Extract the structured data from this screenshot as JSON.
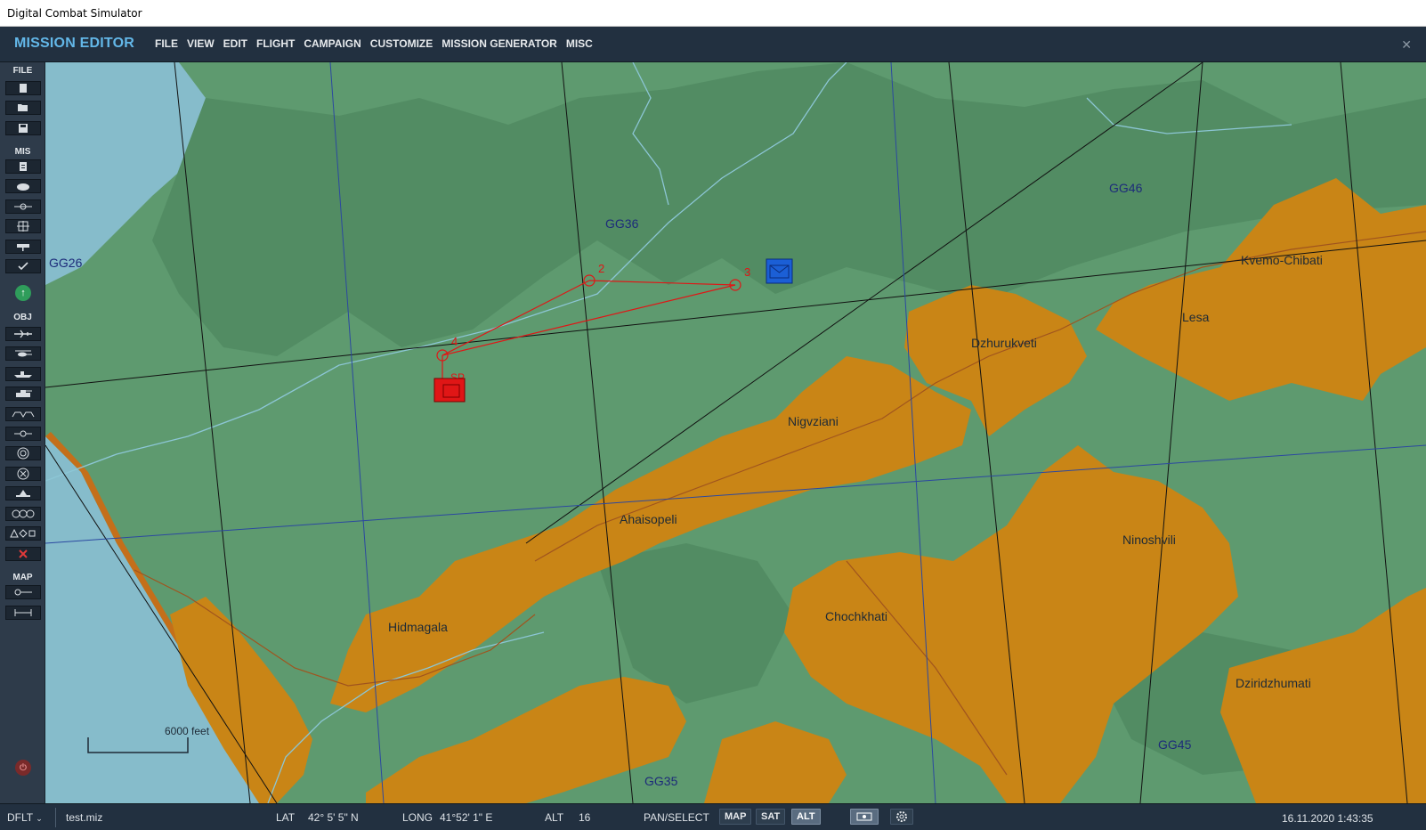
{
  "window": {
    "title": "Digital Combat Simulator"
  },
  "app": {
    "name": "MISSION EDITOR"
  },
  "menu": [
    "FILE",
    "VIEW",
    "EDIT",
    "FLIGHT",
    "CAMPAIGN",
    "CUSTOMIZE",
    "MISSION GENERATOR",
    "MISC"
  ],
  "sidebar": {
    "file_label": "FILE",
    "mis_label": "MIS",
    "obj_label": "OBJ",
    "map_label": "MAP"
  },
  "map": {
    "grid_labels": [
      "GG26",
      "GG36",
      "GG46",
      "GG35",
      "GG45"
    ],
    "towns": [
      "Kvemo-Chibati",
      "Lesa",
      "Dzhurukveti",
      "Nigvziani",
      "Ahaisopeli",
      "Ninoshvili",
      "Chochkhati",
      "Hidmagala",
      "Dziridzhumati"
    ],
    "waypoints": [
      "2",
      "3",
      "4",
      "SP"
    ],
    "scale_label": "6000 feet",
    "colors": {
      "sea": "#86bccb",
      "land": "#5e9a6f",
      "forest": "#518a61",
      "urban": "#c98516",
      "route": "#e01616",
      "blue_unit": "#1b5fd6"
    }
  },
  "status": {
    "preset": "DFLT",
    "file": "test.miz",
    "lat_label": "LAT",
    "lat_value": "42° 5' 5\" N",
    "long_label": "LONG",
    "long_value": "41°52' 1\" E",
    "alt_label": "ALT",
    "alt_value": "16",
    "mode": "PAN/SELECT",
    "map_btn": "MAP",
    "sat_btn": "SAT",
    "alt_btn": "ALT",
    "datetime": "16.11.2020 1:43:35"
  }
}
